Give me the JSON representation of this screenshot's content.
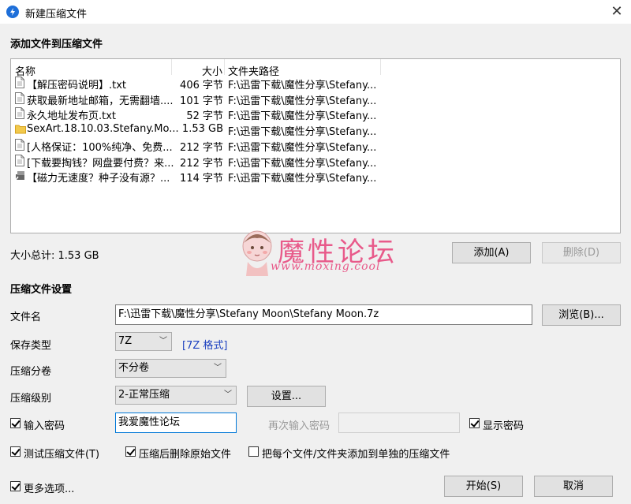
{
  "window": {
    "title": "新建压缩文件",
    "close_label": "✕"
  },
  "add_section": {
    "title": "添加文件到压缩文件"
  },
  "file_list": {
    "columns": {
      "name": "名称",
      "size": "大小",
      "path": "文件夹路径"
    },
    "rows": [
      {
        "icon": "document-icon",
        "name": "【解压密码说明】.txt",
        "size": "406 字节",
        "path": "F:\\迅雷下载\\魔性分享\\Stefany..."
      },
      {
        "icon": "document-icon",
        "name": "获取最新地址邮箱，无需翻墙....",
        "size": "101 字节",
        "path": "F:\\迅雷下载\\魔性分享\\Stefany..."
      },
      {
        "icon": "document-icon",
        "name": "永久地址发布页.txt",
        "size": "52 字节",
        "path": "F:\\迅雷下载\\魔性分享\\Stefany..."
      },
      {
        "icon": "folder-icon",
        "name": "SexArt.18.10.03.Stefany.Mo...",
        "size": "1.53 GB",
        "path": "F:\\迅雷下载\\魔性分享\\Stefany..."
      },
      {
        "icon": "document-icon",
        "name": "[人格保证：100%纯净、免费...",
        "size": "212 字节",
        "path": "F:\\迅雷下载\\魔性分享\\Stefany..."
      },
      {
        "icon": "document-icon",
        "name": "[下载要掏钱？网盘要付费？来...",
        "size": "212 字节",
        "path": "F:\\迅雷下载\\魔性分享\\Stefany..."
      },
      {
        "icon": "shortcut-icon",
        "name": "【磁力无速度？种子没有源？...",
        "size": "114 字节",
        "path": "F:\\迅雷下载\\魔性分享\\Stefany..."
      }
    ]
  },
  "total_size": "大小总计: 1.53 GB",
  "buttons": {
    "add": "添加(A)",
    "delete": "删除(D)",
    "browse": "浏览(B)...",
    "settings": "设置...",
    "start": "开始(S)",
    "cancel": "取消"
  },
  "watermark": {
    "title": "魔性论坛",
    "url": "www.moxing.cool"
  },
  "settings_section": {
    "title": "压缩文件设置",
    "filename_label": "文件名",
    "filename_value": "F:\\迅雷下载\\魔性分享\\Stefany Moon\\Stefany Moon.7z",
    "type_label": "保存类型",
    "type_value": "7Z",
    "type_link": "[7Z 格式]",
    "volume_label": "压缩分卷",
    "volume_value": "不分卷",
    "level_label": "压缩级别",
    "level_value": "2-正常压缩",
    "password_check": "输入密码",
    "password_value": "我爱魔性论坛",
    "repeat_password_label": "再次输入密码",
    "show_password": "显示密码",
    "test_archive": "测试压缩文件(T)",
    "delete_after": "压缩后删除原始文件",
    "separate_archives": "把每个文件/文件夹添加到单独的压缩文件",
    "more_options": "更多选项..."
  },
  "colors": {
    "accent": "#1e6fd9",
    "watermark": "#e85a8a",
    "link": "#1a3fbf"
  }
}
